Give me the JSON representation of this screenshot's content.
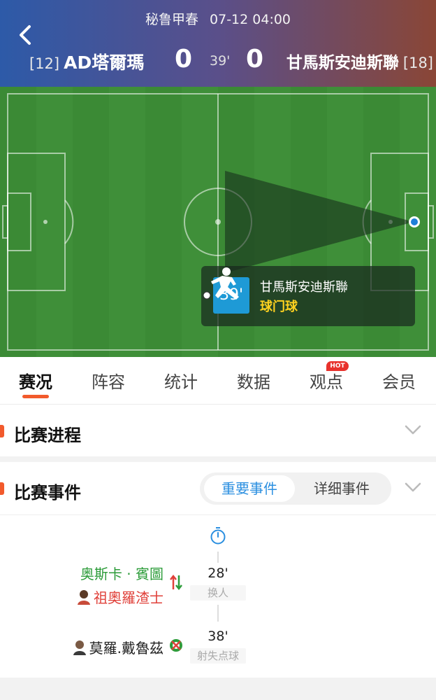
{
  "header": {
    "league": "秘鲁甲春",
    "datetime": "07-12 04:00",
    "home_rank": "[12]",
    "home_name": "AD塔爾瑪",
    "home_score": "0",
    "minute": "39'",
    "away_score": "0",
    "away_name": "甘馬斯安迪斯聯",
    "away_rank": "[18]"
  },
  "live_event": {
    "minute": "39'",
    "team": "甘馬斯安迪斯聯",
    "type": "球门球"
  },
  "tabs": [
    "赛况",
    "阵容",
    "统计",
    "数据",
    "观点",
    "会员"
  ],
  "hot_badge": "HOT",
  "sections": {
    "progress_title": "比赛进程",
    "events_title": "比赛事件",
    "filter_important": "重要事件",
    "filter_detailed": "详细事件"
  },
  "events": [
    {
      "minute": "28'",
      "tag": "换人",
      "player_in": "奥斯卡 · 賓圖",
      "player_out": "祖奧羅渣士"
    },
    {
      "minute": "38'",
      "tag": "射失点球",
      "player": "莫羅.戴魯茲"
    }
  ],
  "colors": {
    "accent": "#f25a2c",
    "blue": "#2b8fe0",
    "sub_in": "#2d9c3a",
    "sub_out": "#e0413a"
  }
}
